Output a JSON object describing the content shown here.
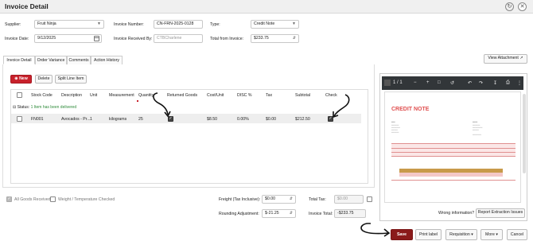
{
  "window": {
    "title": "Invoice Detail"
  },
  "form": {
    "supplier_label": "Supplier:",
    "supplier_value": "Fruit Ninja",
    "invoice_number_label": "Invoice Number:",
    "invoice_number_value": "CN-FRN-2025-0128",
    "type_label": "Type:",
    "type_value": "Credit Note",
    "invoice_date_label": "Invoice Date:",
    "invoice_date_value": "9/12/2025",
    "received_by_label": "Invoice Received By:",
    "received_by_placeholder": "CTBCharlene",
    "total_label": "Total from Invoice:",
    "total_value": "$233.75"
  },
  "tabs": [
    {
      "label": "Invoice Detail"
    },
    {
      "label": "Order Variance"
    },
    {
      "label": "Comments"
    },
    {
      "label": "Action History"
    }
  ],
  "view_attachment": "View Attachment",
  "toolbar": {
    "new": "New",
    "delete": "Delete",
    "split": "Split Line Item"
  },
  "grid": {
    "headers": [
      "Stock Code",
      "Description",
      "Unit",
      "Measurement",
      "Quantity",
      "Returned Goods",
      "Cost/Unit",
      "DISC %",
      "Tax",
      "Subtotal",
      "Check"
    ],
    "status_prefix": "Status:",
    "status_text": "1 Item has been delivered",
    "row": {
      "stock_code": "FN001",
      "description": "Avocados - Pr...",
      "unit": "1",
      "measurement": "kilograms",
      "quantity": "25",
      "cost": "$8.50",
      "disc": "0.00%",
      "tax": "$0.00",
      "subtotal": "$212.50",
      "returned": true,
      "check": true
    }
  },
  "footer": {
    "all_goods": "All Goods Received",
    "weight_temp": "Weight / Temperature Checked",
    "freight_label": "Freight (Tax Inclusive):",
    "freight_value": "$0.00",
    "total_tax_label": "Total Tax:",
    "total_tax_value": "$0.00",
    "rounding_label": "Rounding Adjustment:",
    "rounding_value": "$-21.25",
    "invoice_total_label": "Invoice Total:",
    "invoice_total_value": "-$233.75"
  },
  "preview": {
    "page_indicator": "1",
    "page_sep": "/",
    "page_total": "1",
    "doc_title": "CREDIT NOTE",
    "wrong_info": "Wrong information?",
    "report_btn": "Report Extraction Issues"
  },
  "actions": {
    "save": "Save",
    "print": "Print label",
    "requisition": "Requisition",
    "more": "More",
    "cancel": "Cancel"
  },
  "colors": {
    "accent": "#c8212b",
    "save": "#8a1a1a",
    "status_green": "#2e8b3a"
  }
}
